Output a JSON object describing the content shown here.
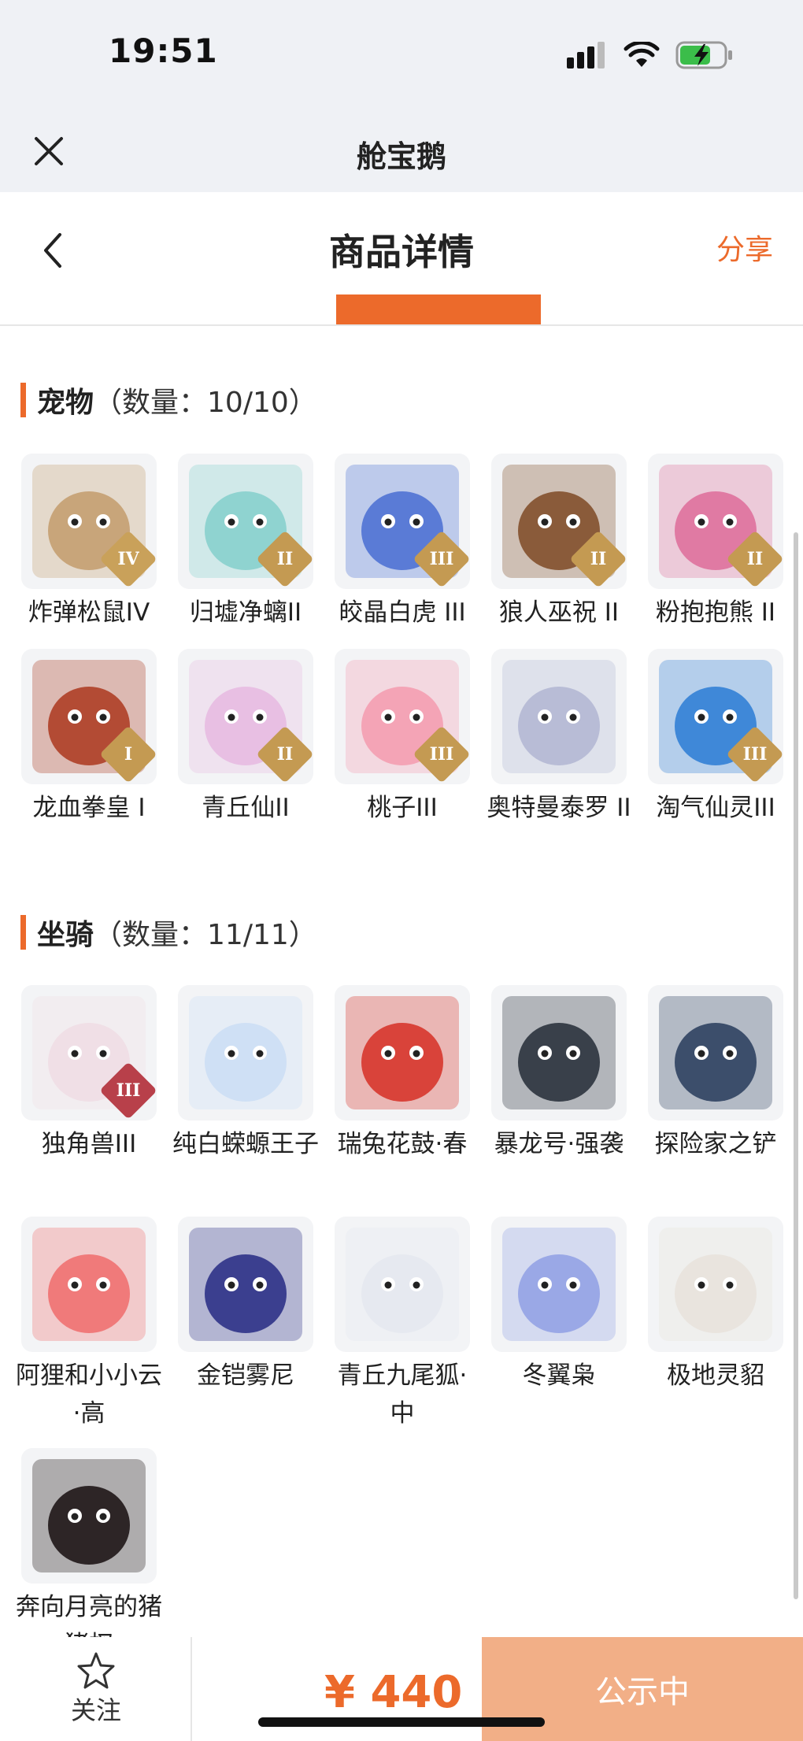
{
  "status_bar": {
    "time": "19:51"
  },
  "app_header": {
    "title": "舱宝鹅"
  },
  "nav": {
    "title": "商品详情",
    "share": "分享"
  },
  "pets": {
    "name": "宠物",
    "count": "（数量：10/10）",
    "items": [
      {
        "name": "炸弹松鼠IV",
        "rank": "IV",
        "rank_color": "#c9a15a",
        "color": "#c8a57a"
      },
      {
        "name": "归墟净螭II",
        "rank": "II",
        "rank_color": "#c49a52",
        "color": "#8fd3d0"
      },
      {
        "name": "皎晶白虎 III",
        "rank": "III",
        "rank_color": "#c49a52",
        "color": "#5a7bd6"
      },
      {
        "name": "狼人巫祝 II",
        "rank": "II",
        "rank_color": "#c49a52",
        "color": "#8a5b3a"
      },
      {
        "name": "粉抱抱熊 II",
        "rank": "II",
        "rank_color": "#c49a52",
        "color": "#e07aa3"
      },
      {
        "name": "龙血拳皇 I",
        "rank": "I",
        "rank_color": "#c49a52",
        "color": "#b34b34"
      },
      {
        "name": "青丘仙II",
        "rank": "II",
        "rank_color": "#c49a52",
        "color": "#e8bfe3"
      },
      {
        "name": "桃子III",
        "rank": "III",
        "rank_color": "#c49a52",
        "color": "#f4a4b6"
      },
      {
        "name": "奥特曼泰罗 II",
        "rank": "",
        "rank_color": "#c49a52",
        "color": "#b8bcd6"
      },
      {
        "name": "淘气仙灵III",
        "rank": "III",
        "rank_color": "#c49a52",
        "color": "#3f88d8"
      }
    ]
  },
  "mounts": {
    "name": "坐骑",
    "count": "（数量：11/11）",
    "items": [
      {
        "name": "独角兽III",
        "rank": "III",
        "rank_color": "#b8404a",
        "color": "#f0dfe6"
      },
      {
        "name": "纯白蝾螈王子",
        "rank": "",
        "rank_color": "",
        "color": "#cfe0f5"
      },
      {
        "name": "瑞兔花鼓·春",
        "rank": "",
        "rank_color": "",
        "color": "#d9433a"
      },
      {
        "name": "暴龙号·强袭",
        "rank": "",
        "rank_color": "",
        "color": "#39404a"
      },
      {
        "name": "探险家之铲",
        "rank": "",
        "rank_color": "",
        "color": "#3c4e6b"
      },
      {
        "name": "阿狸和小小云·高",
        "rank": "",
        "rank_color": "",
        "color": "#f07a7a"
      },
      {
        "name": "金铠雾尼",
        "rank": "",
        "rank_color": "",
        "color": "#3b3f8f"
      },
      {
        "name": "青丘九尾狐·中",
        "rank": "",
        "rank_color": "",
        "color": "#e6e9f0"
      },
      {
        "name": "冬翼枭",
        "rank": "",
        "rank_color": "",
        "color": "#9aa8e6"
      },
      {
        "name": "极地灵貂",
        "rank": "",
        "rank_color": "",
        "color": "#e9e4de"
      },
      {
        "name": "奔向月亮的猪猪杈",
        "rank": "",
        "rank_color": "",
        "color": "#2d2526"
      }
    ]
  },
  "bottom": {
    "follow_label": "关注",
    "price": "¥ 440",
    "status_button": "公示中"
  },
  "colors": {
    "accent": "#ec6a2b",
    "status_button_bg": "#f2af87"
  }
}
